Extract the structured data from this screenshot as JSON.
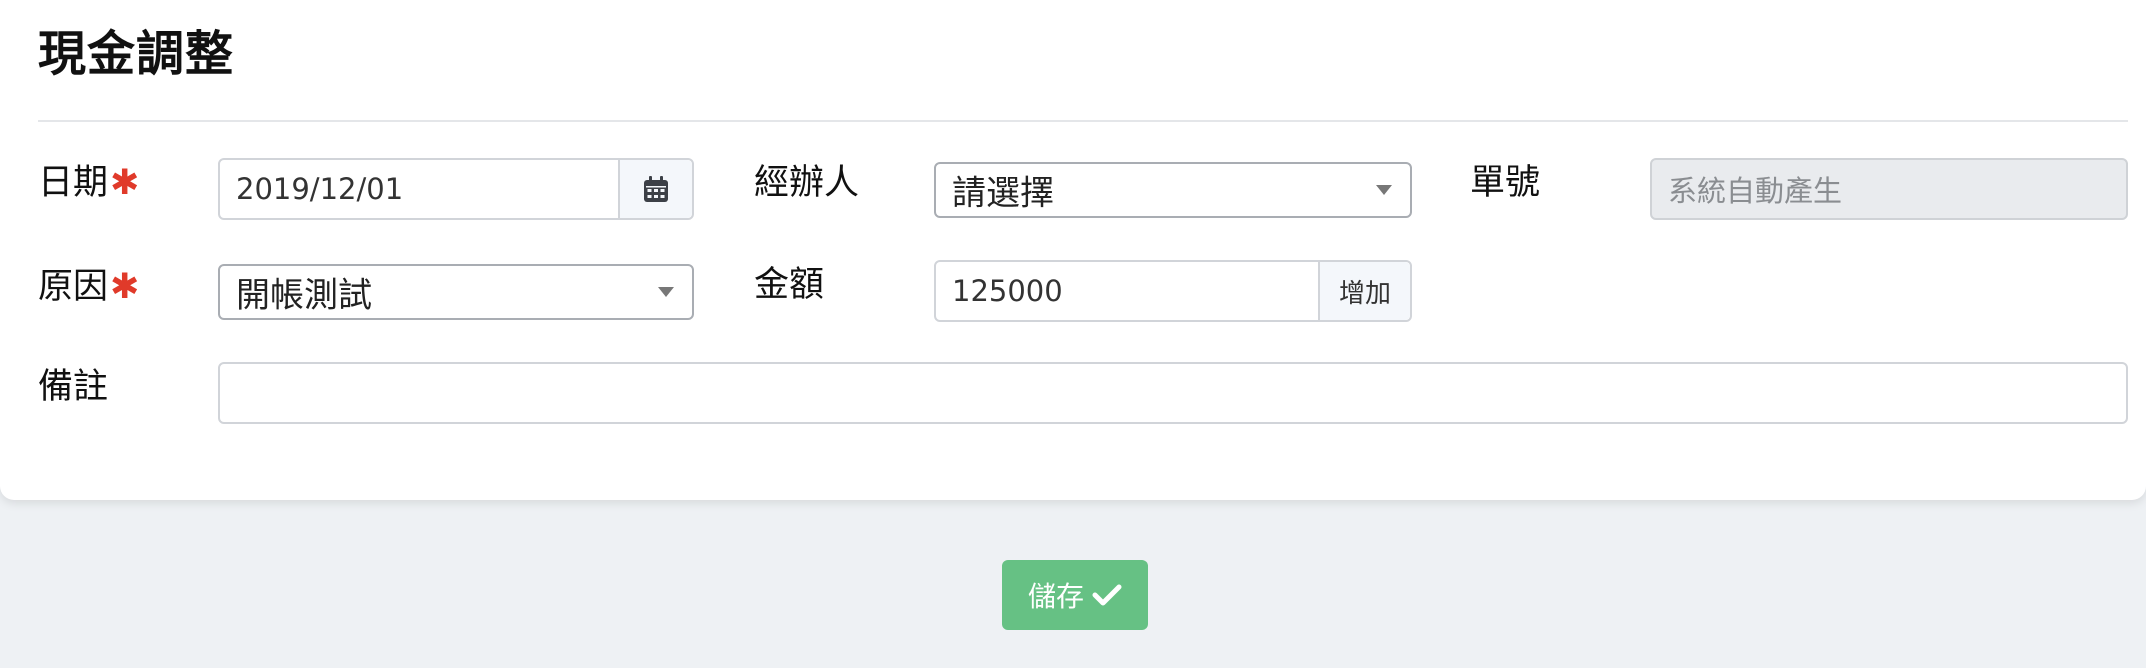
{
  "form": {
    "title": "現金調整",
    "required_mark": "✱",
    "date": {
      "label": "日期",
      "value": "2019/12/01",
      "icon": "calendar-icon"
    },
    "handler": {
      "label": "經辦人",
      "selected": "請選擇"
    },
    "doc_no": {
      "label": "單號",
      "placeholder": "系統自動產生"
    },
    "reason": {
      "label": "原因",
      "selected": "開帳測試"
    },
    "amount": {
      "label": "金額",
      "value": "125000",
      "action_label": "增加"
    },
    "note": {
      "label": "備註",
      "value": ""
    }
  },
  "actions": {
    "save_label": "儲存",
    "save_icon": "check-icon",
    "save_color": "#66c184"
  },
  "colors": {
    "required": "#e03a2a"
  }
}
